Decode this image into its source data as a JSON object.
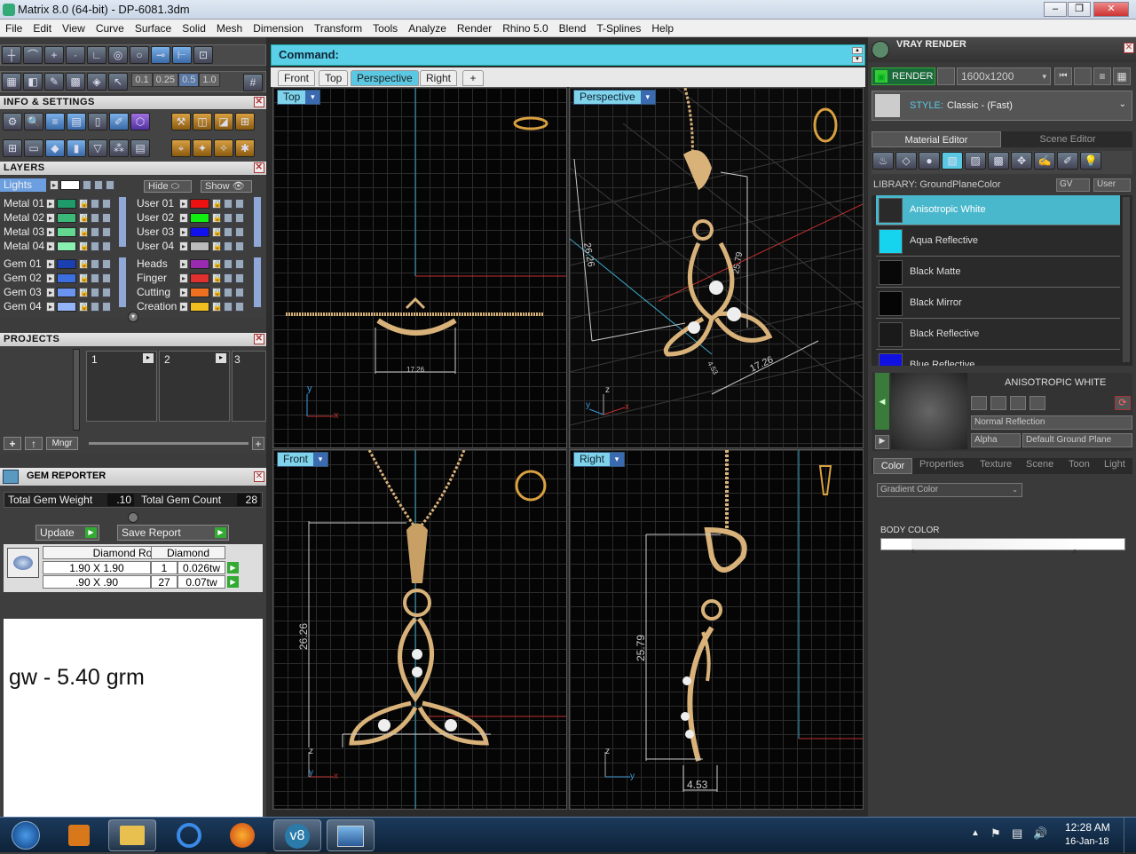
{
  "window": {
    "title": "Matrix 8.0 (64-bit) - DP-6081.3dm",
    "minimize_icon": "minimize-icon",
    "maximize_icon": "restore-icon",
    "close_icon": "close-icon"
  },
  "menu": [
    "File",
    "Edit",
    "View",
    "Curve",
    "Surface",
    "Solid",
    "Mesh",
    "Dimension",
    "Transform",
    "Tools",
    "Analyze",
    "Render",
    "Rhino 5.0",
    "Blend",
    "T-Splines",
    "Help"
  ],
  "toolbar": {
    "scale_values": [
      "0.1",
      "0.25",
      "0.5",
      "1.0"
    ]
  },
  "info_settings": {
    "title": "INFO & SETTINGS"
  },
  "layers": {
    "title": "LAYERS",
    "lights_label": "Lights",
    "hide_label": "Hide",
    "show_label": "Show",
    "rows_left": [
      {
        "name": "Metal 01",
        "color": "#1f9a6a"
      },
      {
        "name": "Metal 02",
        "color": "#3cb878"
      },
      {
        "name": "Metal 03",
        "color": "#62d890"
      },
      {
        "name": "Metal 04",
        "color": "#8af0b0"
      },
      {
        "name": "Gem 01",
        "color": "#1a3fb0"
      },
      {
        "name": "Gem 02",
        "color": "#3d6ee0"
      },
      {
        "name": "Gem 03",
        "color": "#6b94f0"
      },
      {
        "name": "Gem 04",
        "color": "#93b4f8"
      }
    ],
    "rows_right": [
      {
        "name": "User 01",
        "color": "#ee1111"
      },
      {
        "name": "User 02",
        "color": "#11ee11"
      },
      {
        "name": "User 03",
        "color": "#1111ee"
      },
      {
        "name": "User 04",
        "color": "#bbbbbb"
      },
      {
        "name": "Heads",
        "color": "#9a2ab0"
      },
      {
        "name": "Finger",
        "color": "#e03030"
      },
      {
        "name": "Cutting",
        "color": "#ee7020"
      },
      {
        "name": "Creation",
        "color": "#f0c020"
      }
    ]
  },
  "projects": {
    "title": "PROJECTS",
    "slots": [
      "1",
      "2",
      "3"
    ],
    "mngr_label": "Mngr"
  },
  "gem_reporter": {
    "title": "GEM REPORTER",
    "total_weight_label": "Total Gem Weight",
    "total_weight_value": ".10",
    "total_count_label": "Total Gem Count",
    "total_count_value": "28",
    "update_label": "Update",
    "save_label": "Save Report",
    "col1": "Diamond Round",
    "col2": "Diamond",
    "rows": [
      {
        "size": "1.90 X 1.90",
        "count": "1",
        "weight": "0.026tw"
      },
      {
        "size": ".90 X .90",
        "count": "27",
        "weight": "0.07tw"
      }
    ]
  },
  "note": "gw - 5.40 grm",
  "command": {
    "label": "Command:"
  },
  "view_tabs": [
    "Front",
    "Top",
    "Perspective",
    "Right",
    "+"
  ],
  "viewports": {
    "top": {
      "label": "Top",
      "dim": "17.26"
    },
    "perspective": {
      "label": "Perspective",
      "dim1": "26.26",
      "dim2": "25.79",
      "dim3": "17.26",
      "dim4": "4.53"
    },
    "front": {
      "label": "Front",
      "dim": "26.26"
    },
    "right": {
      "label": "Right",
      "dim1": "25.79",
      "dim2": "4.53"
    }
  },
  "vray": {
    "title": "VRAY RENDER",
    "render_label": "RENDER",
    "resolution": "1600x1200",
    "style_label": "STYLE:",
    "style_value": "Classic - (Fast)",
    "tab_material": "Material Editor",
    "tab_scene": "Scene Editor",
    "library_label": "LIBRARY: GroundPlaneColor",
    "gv_label": "GV",
    "user_label": "User",
    "materials": [
      {
        "name": "Anisotropic White",
        "color": "#2a2a2a",
        "selected": true
      },
      {
        "name": "Aqua Reflective",
        "color": "#16d4ee",
        "selected": false
      },
      {
        "name": "Black Matte",
        "color": "#080808",
        "selected": false
      },
      {
        "name": "Black Mirror",
        "color": "#050505",
        "selected": false
      },
      {
        "name": "Black Reflective",
        "color": "#1a1a1a",
        "selected": false
      },
      {
        "name": "Blue Reflective",
        "color": "#1010e0",
        "selected": false
      }
    ],
    "preview_title": "ANISOTROPIC WHITE",
    "reflection": "Normal Reflection",
    "alpha_label": "Alpha",
    "ground_label": "Default Ground Plane",
    "prop_tabs": [
      "Color",
      "Properties",
      "Texture",
      "Scene",
      "Toon",
      "Light"
    ],
    "gradient_select": "Gradient Color",
    "body_color_label": "BODY COLOR"
  },
  "taskbar": {
    "time": "12:28 AM",
    "date": "16-Jan-18",
    "apps": [
      "start-orb-icon",
      "media-player-icon",
      "explorer-icon",
      "internet-explorer-icon",
      "firefox-icon",
      "matrix-v8-icon",
      "picture-viewer-icon"
    ]
  },
  "colors": {
    "accent": "#5ac8e2",
    "gold": "#d9b27a",
    "grid": "#2c2c2c"
  }
}
